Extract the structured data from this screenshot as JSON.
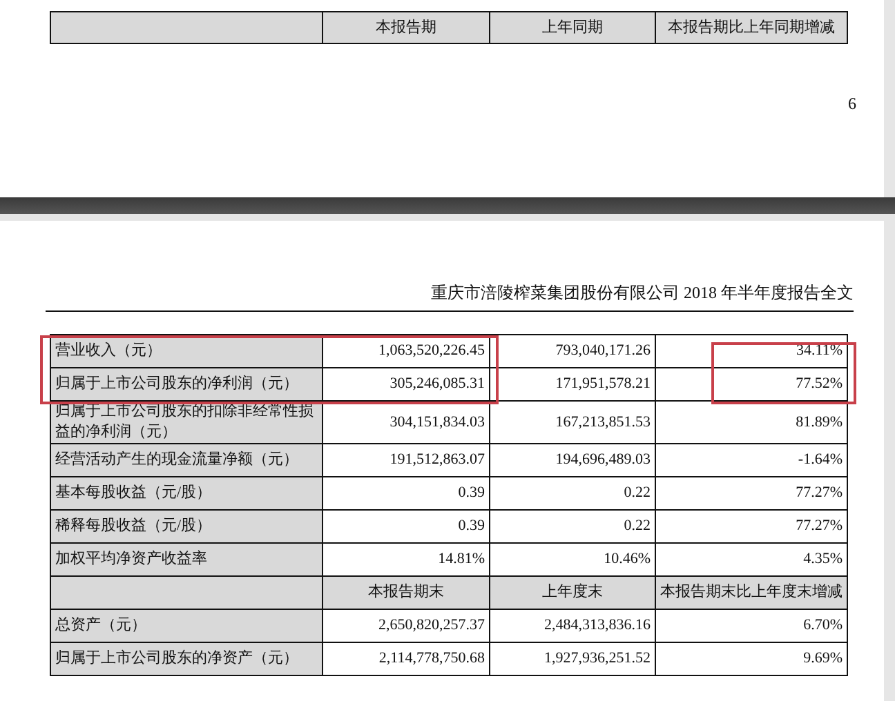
{
  "page_1": {
    "table": {
      "rows": [
        {
          "kind": "header",
          "label": "",
          "values": [
            "本报告期",
            "上年同期",
            "本报告期比上年同期增减"
          ]
        }
      ]
    },
    "page_number": "6"
  },
  "page_2": {
    "running_header": "重庆市涪陵榨菜集团股份有限公司 2018 年半年度报告全文",
    "table": {
      "rows": [
        {
          "kind": "data",
          "label": "营业收入（元）",
          "values": [
            "1,063,520,226.45",
            "793,040,171.26",
            "34.11%"
          ],
          "highlight_values": true,
          "highlight_change": true
        },
        {
          "kind": "data",
          "label": "归属于上市公司股东的净利润（元）",
          "values": [
            "305,246,085.31",
            "171,951,578.21",
            "77.52%"
          ],
          "highlight_values": true,
          "highlight_change": true
        },
        {
          "kind": "data",
          "label": "归属于上市公司股东的扣除非经常性损益的净利润（元）",
          "values": [
            "304,151,834.03",
            "167,213,851.53",
            "81.89%"
          ]
        },
        {
          "kind": "data",
          "label": "经营活动产生的现金流量净额（元）",
          "values": [
            "191,512,863.07",
            "194,696,489.03",
            "-1.64%"
          ]
        },
        {
          "kind": "data",
          "label": "基本每股收益（元/股）",
          "values": [
            "0.39",
            "0.22",
            "77.27%"
          ]
        },
        {
          "kind": "data",
          "label": "稀释每股收益（元/股）",
          "values": [
            "0.39",
            "0.22",
            "77.27%"
          ]
        },
        {
          "kind": "data",
          "label": "加权平均净资产收益率",
          "values": [
            "14.81%",
            "10.46%",
            "4.35%"
          ]
        },
        {
          "kind": "header",
          "label": "",
          "values": [
            "本报告期末",
            "上年度末",
            "本报告期末比上年度末增减"
          ]
        },
        {
          "kind": "data",
          "label": "总资产（元）",
          "values": [
            "2,650,820,257.37",
            "2,484,313,836.16",
            "6.70%"
          ]
        },
        {
          "kind": "data",
          "label": "归属于上市公司股东的净资产（元）",
          "values": [
            "2,114,778,750.68",
            "1,927,936,251.52",
            "9.69%"
          ]
        }
      ]
    }
  }
}
